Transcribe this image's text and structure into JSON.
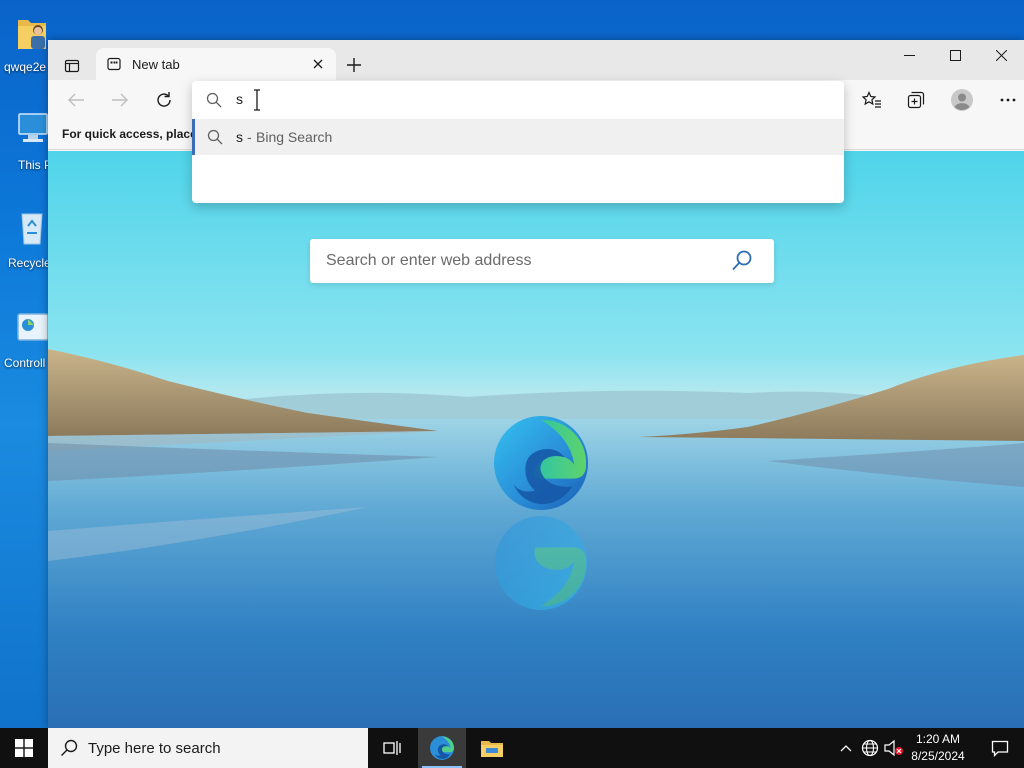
{
  "desktop": {
    "icons": [
      {
        "label": "qwqe2e",
        "icon": "user-folder-icon"
      },
      {
        "label": "This P",
        "icon": "this-pc-icon"
      },
      {
        "label": "Recycle",
        "icon": "recycle-bin-icon"
      },
      {
        "label": "Controll",
        "icon": "control-panel-icon"
      }
    ]
  },
  "browser": {
    "tab": {
      "title": "New tab",
      "icon": "new-tab-page-icon"
    },
    "window_controls": {
      "minimize": "minimize-icon",
      "maximize": "maximize-icon",
      "close": "close-icon"
    },
    "toolbar": {
      "back": "back-arrow-icon",
      "forward": "forward-arrow-icon",
      "refresh": "refresh-icon",
      "favorites": "favorites-icon",
      "collections": "collections-icon",
      "profile": "profile-avatar-icon",
      "more": "more-options-icon"
    },
    "favorites_bar": {
      "text": "For quick access, place y"
    },
    "address_dropdown": {
      "input_value": "s",
      "suggestion": {
        "query": "s",
        "separator": "-",
        "engine": "Bing Search"
      }
    },
    "new_tab_page": {
      "search_placeholder": "Search or enter web address",
      "logo": "microsoft-edge-logo"
    }
  },
  "taskbar": {
    "search_placeholder": "Type here to search",
    "apps": [
      {
        "name": "task-view",
        "icon": "task-view-icon"
      },
      {
        "name": "edge",
        "icon": "edge-icon",
        "active": true
      },
      {
        "name": "file-explorer",
        "icon": "file-explorer-icon"
      }
    ],
    "tray": {
      "icons": [
        "show-hidden-icons-chevron",
        "network-icon",
        "volume-muted-icon"
      ]
    },
    "clock": {
      "time": "1:20 AM",
      "date": "8/25/2024"
    }
  },
  "colors": {
    "desktop_blue": "#0d79d9",
    "taskbar_bg": "#101010",
    "suggestion_accent": "#3a6cb5",
    "search_icon_blue": "#2b6cb8"
  }
}
